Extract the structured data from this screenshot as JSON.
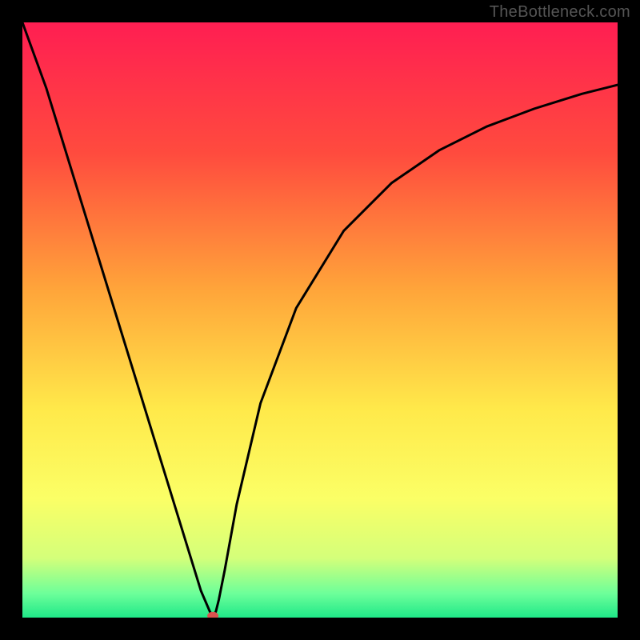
{
  "watermark": "TheBottleneck.com",
  "chart_data": {
    "type": "line",
    "title": "",
    "xlabel": "",
    "ylabel": "",
    "xlim": [
      0,
      100
    ],
    "ylim": [
      0,
      100
    ],
    "background_gradient": {
      "stops": [
        {
          "offset": 0,
          "color": "#ff1e52"
        },
        {
          "offset": 22,
          "color": "#ff4b3e"
        },
        {
          "offset": 45,
          "color": "#ffa53a"
        },
        {
          "offset": 65,
          "color": "#ffe94a"
        },
        {
          "offset": 80,
          "color": "#fbff66"
        },
        {
          "offset": 90,
          "color": "#d4ff7a"
        },
        {
          "offset": 96,
          "color": "#6cff9a"
        },
        {
          "offset": 100,
          "color": "#1fe888"
        }
      ]
    },
    "series": [
      {
        "name": "bottleneck-curve",
        "color": "#000000",
        "x": [
          0,
          4,
          8,
          12,
          16,
          20,
          24,
          28,
          30,
          31.5,
          32,
          32.5,
          33,
          34,
          36,
          40,
          46,
          54,
          62,
          70,
          78,
          86,
          94,
          100
        ],
        "values": [
          102,
          89,
          76,
          63,
          50,
          37,
          24,
          11,
          4.5,
          1.0,
          0.3,
          1.0,
          3.0,
          8.0,
          19,
          36,
          52,
          65,
          73,
          78.5,
          82.5,
          85.5,
          88,
          89.5
        ]
      }
    ],
    "marker": {
      "name": "bottleneck-point",
      "x": 32,
      "y": 0.3,
      "color": "#d9534f",
      "rx": 7,
      "ry": 5
    }
  }
}
